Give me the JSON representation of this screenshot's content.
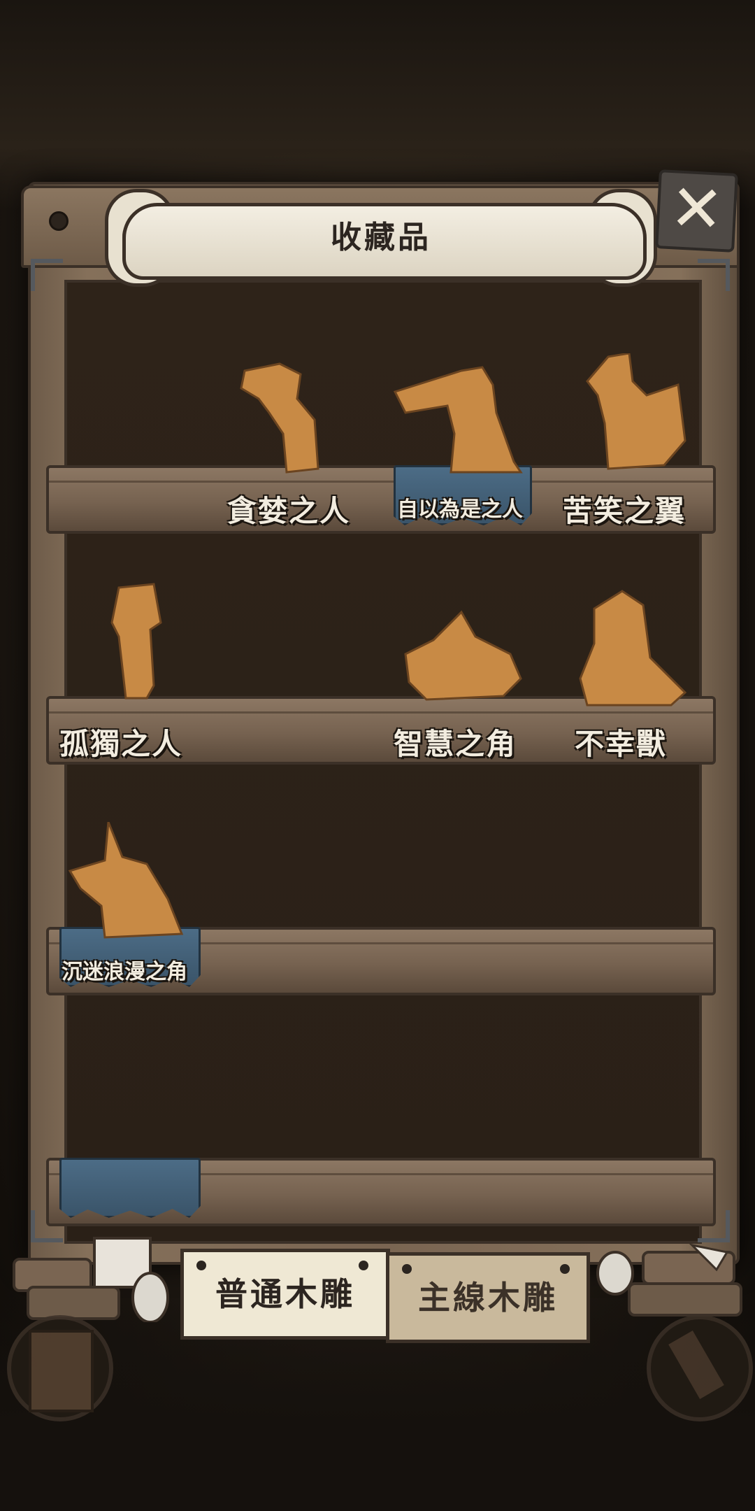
{
  "header": {
    "title": "收藏品",
    "close_icon": "close-x-icon"
  },
  "shelves": [
    {
      "items": [
        {
          "name": "貪婪之人",
          "highlight": false,
          "figure": "hunched-man-icon"
        },
        {
          "name": "自以為是之人",
          "highlight": true,
          "figure": "long-snout-man-icon"
        },
        {
          "name": "苦笑之翼",
          "highlight": false,
          "figure": "rooster-icon"
        }
      ]
    },
    {
      "items": [
        {
          "name": "孤獨之人",
          "highlight": false,
          "figure": "girl-icon"
        },
        {
          "name": "智慧之角",
          "highlight": false,
          "figure": "turtle-icon"
        },
        {
          "name": "不幸獸",
          "highlight": false,
          "figure": "seal-icon"
        }
      ]
    },
    {
      "items": [
        {
          "name": "沉迷浪漫之角",
          "highlight": true,
          "figure": "horned-dog-icon"
        }
      ]
    }
  ],
  "tabs": [
    {
      "label": "普通木雕",
      "active": true
    },
    {
      "label": "主線木雕",
      "active": false
    }
  ],
  "colors": {
    "wood": "#7a6552",
    "plate_blue": "#4c6c86",
    "figure_gold": "#c88a45",
    "paper": "#efe8d4"
  }
}
